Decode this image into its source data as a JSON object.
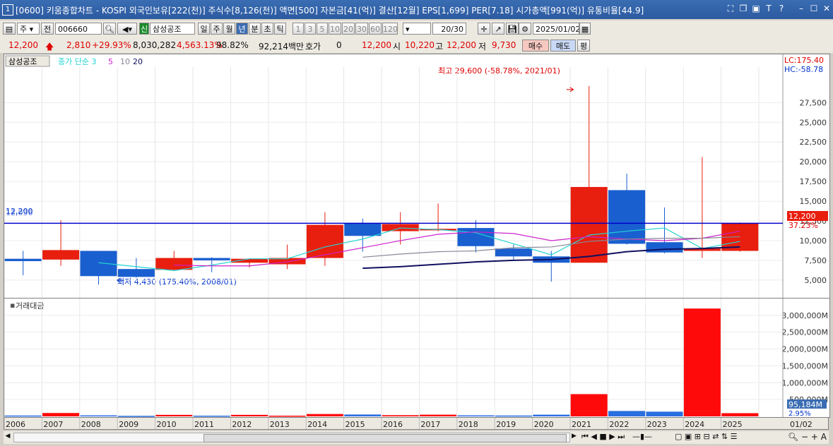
{
  "title_bar": {
    "window_no": "1",
    "title": "[0600] 키움종합차트 - KOSPI 외국인보유[222(천)] 주식수[8,126(천)] 액면[500] 자본금[41(억)] 결산[12월] EPS[1,699] PER[7.18] 시가총액[991(억)] 유통비율[44.9]",
    "help": "?",
    "text_t": "T"
  },
  "toolbar": {
    "type_select": "주",
    "jeon_label": "전",
    "stock_code": "006660",
    "stock_badge": "신",
    "stock_name": "삼성공조",
    "periods": [
      "일",
      "주",
      "월",
      "년",
      "분",
      "초",
      "틱"
    ],
    "active_period": "년",
    "counts": [
      "1",
      "3",
      "5",
      "10",
      "20",
      "30",
      "60",
      "120"
    ],
    "range": "20/30",
    "date": "2025/01/02"
  },
  "quote": {
    "price": "12,200",
    "change": "2,810",
    "change_pct": "+29.93%",
    "volume": "8,030,282",
    "volume_pct": "4,563.13%",
    "rate": "98.82%",
    "amount": "92,214백만",
    "hoga_label": "호가",
    "hoga_value": "0",
    "hoga_price": "12,200",
    "open_label": "시",
    "open": "10,220",
    "high_label": "고",
    "high": "12,200",
    "low_label": "저",
    "low": "9,730",
    "buy_label": "매수",
    "sell_label": "매도",
    "eval_label": "평"
  },
  "legend": {
    "stock": "삼성공조",
    "ma_label": "종가 단순 3",
    "ma5": "5",
    "ma10": "10",
    "ma20": "20"
  },
  "labels": {
    "lc": "LC:175.40",
    "hc": "HC:-58.78",
    "max_note": "최고 29,600 (-58.78%, 2021/01)",
    "min_note": "최저 4,430 (175.40%, 2008/01)",
    "left_price": "12,200",
    "left_price2": "12,036",
    "cur_price": "12,200",
    "cur_pct": "37.23%",
    "vol_title": "거래대금",
    "vol_cur": "95,184M",
    "vol_pct": "2.95%",
    "x_end": "01/02"
  },
  "colors": {
    "up": "#e81e0e",
    "down": "#1a5fd0",
    "ma3": "#22d3d3",
    "ma5": "#cc22cc",
    "ma10": "#888899",
    "ma20": "#101060",
    "line": "#0000cc"
  },
  "chart_data": {
    "type": "candlestick",
    "x": [
      "2006",
      "2007",
      "2008",
      "2009",
      "2010",
      "2011",
      "2012",
      "2013",
      "2014",
      "2015",
      "2016",
      "2017",
      "2018",
      "2019",
      "2020",
      "2021",
      "2022",
      "2023",
      "2024",
      "2025"
    ],
    "open": [
      7700,
      7600,
      8700,
      6400,
      6300,
      7800,
      7200,
      7000,
      7800,
      12200,
      11200,
      11300,
      11600,
      9000,
      8000,
      7200,
      16400,
      9800,
      8700,
      8700
    ],
    "high": [
      8700,
      12600,
      8700,
      7800,
      8700,
      7900,
      7700,
      9500,
      13600,
      12800,
      13600,
      14700,
      12600,
      9500,
      8700,
      29600,
      18500,
      14200,
      20600,
      12300
    ],
    "low": [
      5600,
      6800,
      4430,
      5300,
      6200,
      6000,
      6600,
      6400,
      6800,
      8600,
      9500,
      11200,
      8500,
      7600,
      4800,
      7200,
      9500,
      8400,
      7800,
      8600
    ],
    "close": [
      7400,
      8800,
      5500,
      5400,
      7800,
      7500,
      7700,
      7800,
      12000,
      10600,
      12100,
      11500,
      9300,
      8000,
      7200,
      16800,
      9600,
      8500,
      9000,
      12200
    ],
    "ma3": [
      null,
      null,
      7200,
      6700,
      6200,
      6900,
      7700,
      7700,
      9200,
      10200,
      11600,
      11400,
      11000,
      9600,
      8200,
      10700,
      11200,
      11600,
      9000,
      9900
    ],
    "ma5": [
      null,
      null,
      null,
      null,
      6900,
      6800,
      6800,
      7300,
      8200,
      9100,
      10000,
      10800,
      11100,
      10900,
      10000,
      10500,
      10200,
      10000,
      10300,
      11200
    ],
    "ma10": [
      null,
      null,
      null,
      null,
      null,
      null,
      null,
      null,
      null,
      7900,
      8300,
      8600,
      8700,
      9100,
      9200,
      9900,
      10200,
      10300,
      10300,
      10500
    ],
    "ma20": [
      null,
      null,
      null,
      null,
      null,
      null,
      null,
      null,
      null,
      6500,
      6700,
      7000,
      7300,
      7500,
      7600,
      8000,
      8600,
      8900,
      9000,
      9200
    ],
    "amount_m": [
      25000,
      100000,
      30000,
      15000,
      45000,
      20000,
      45000,
      20000,
      70000,
      55000,
      35000,
      50000,
      30000,
      25000,
      50000,
      660000,
      160000,
      140000,
      3200000,
      95184
    ],
    "price_ticks": [
      5000,
      7500,
      10000,
      12500,
      15000,
      17500,
      20000,
      22500,
      25000,
      27500
    ],
    "price_tick_labels": [
      "5,000",
      "7,500",
      "10,000",
      "12,500",
      "15,000",
      "17,500",
      "20,000",
      "22,500",
      "25,000",
      "27,500"
    ],
    "price_range": [
      3200,
      32000
    ],
    "amount_ticks": [
      500000,
      1000000,
      1500000,
      2000000,
      2500000,
      3000000
    ],
    "amount_tick_labels": [
      "500,000M",
      "1,000,000M",
      "1,500,000M",
      "2,000,000M",
      "2,500,000M",
      "3,000,000M"
    ],
    "amount_range": [
      0,
      3330000
    ],
    "current_line": 12200
  }
}
